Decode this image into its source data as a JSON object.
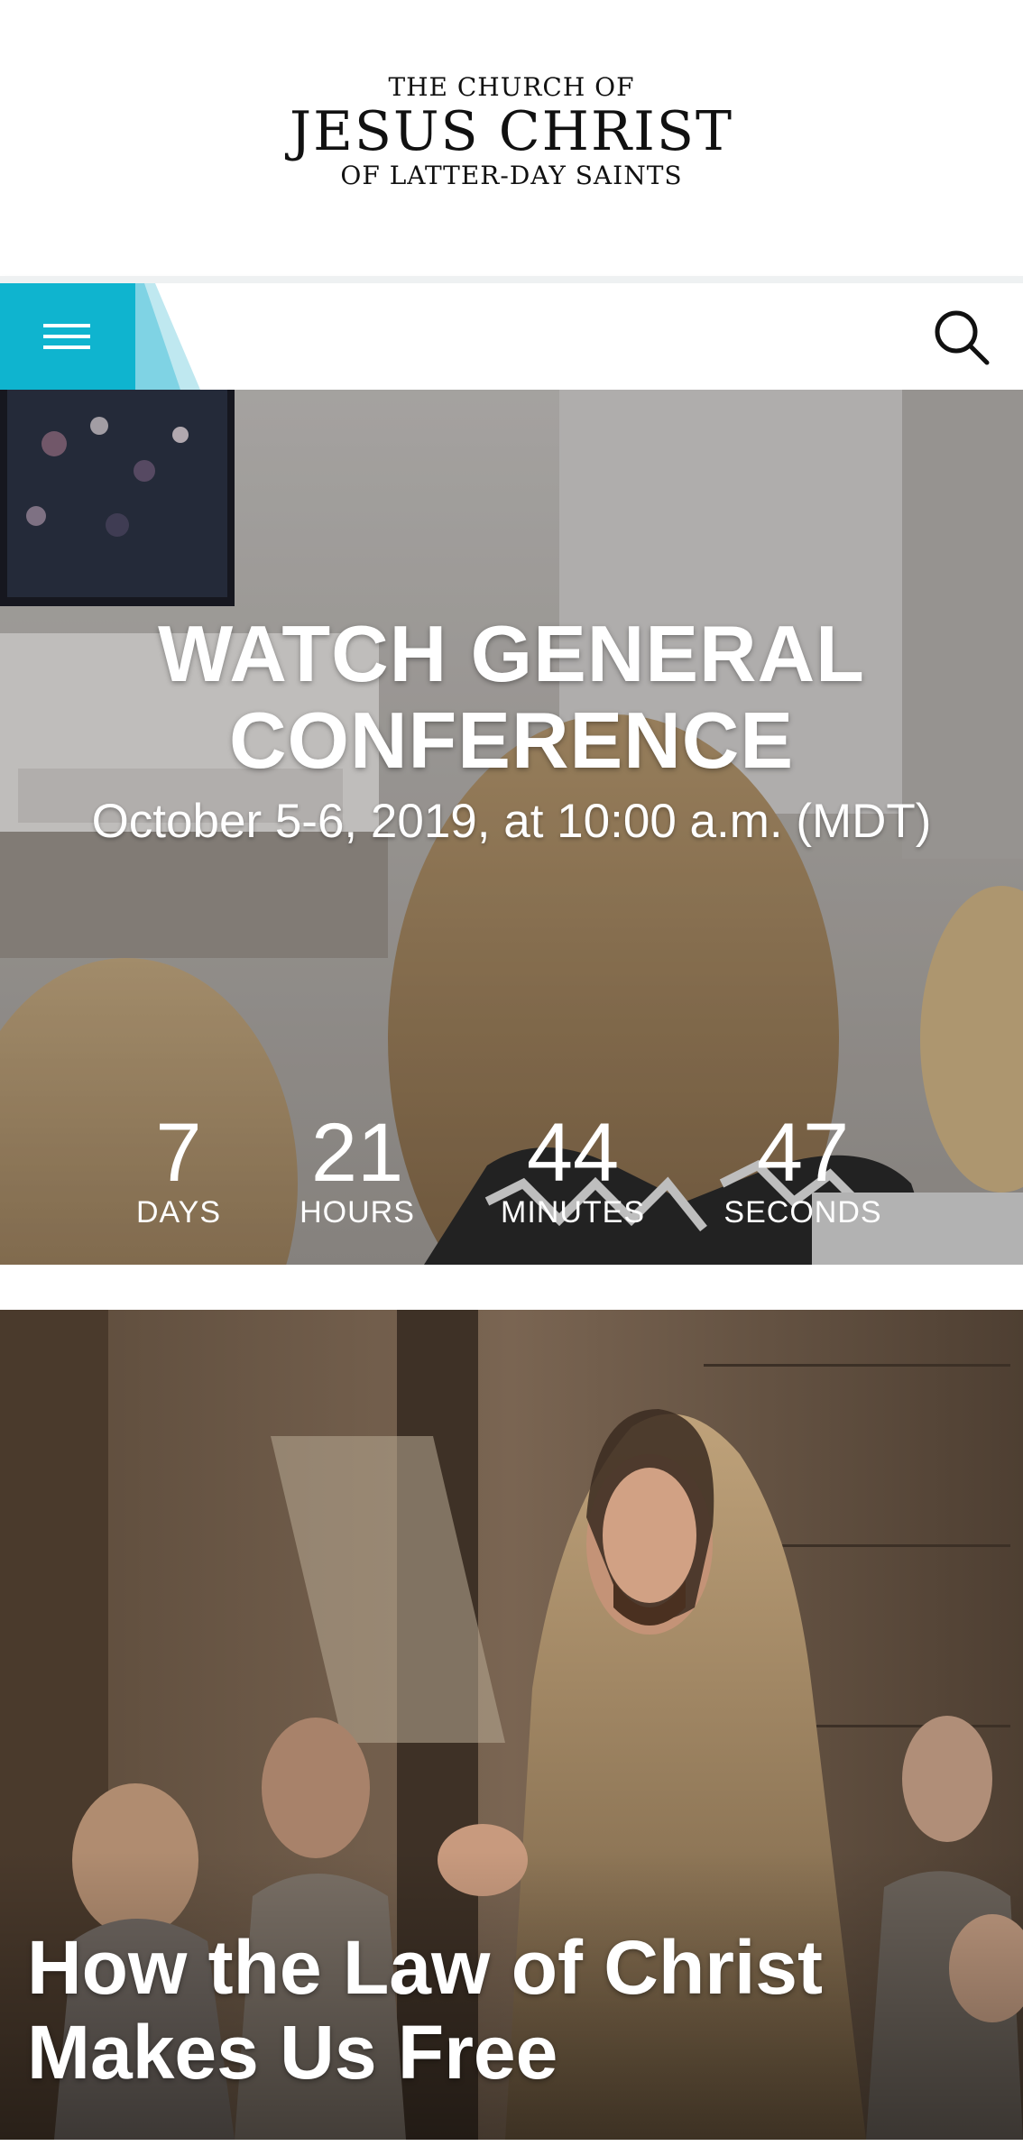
{
  "brand": {
    "line1": "THE CHURCH OF",
    "line2": "JESUS CHRIST",
    "line3": "OF LATTER-DAY SAINTS"
  },
  "nav": {
    "menu_icon": "hamburger-icon",
    "search_icon": "search-icon",
    "accent_color": "#0fb4cf"
  },
  "hero": {
    "title_line1": "WATCH GENERAL",
    "title_line2": "CONFERENCE",
    "subtitle": "October 5-6, 2019, at 10:00 a.m. (MDT)",
    "countdown": [
      {
        "value": "7",
        "label": "DAYS"
      },
      {
        "value": "21",
        "label": "HOURS"
      },
      {
        "value": "44",
        "label": "MINUTES"
      },
      {
        "value": "47",
        "label": "SECONDS"
      }
    ]
  },
  "feature": {
    "title": "How the Law of Christ Makes Us Free"
  }
}
